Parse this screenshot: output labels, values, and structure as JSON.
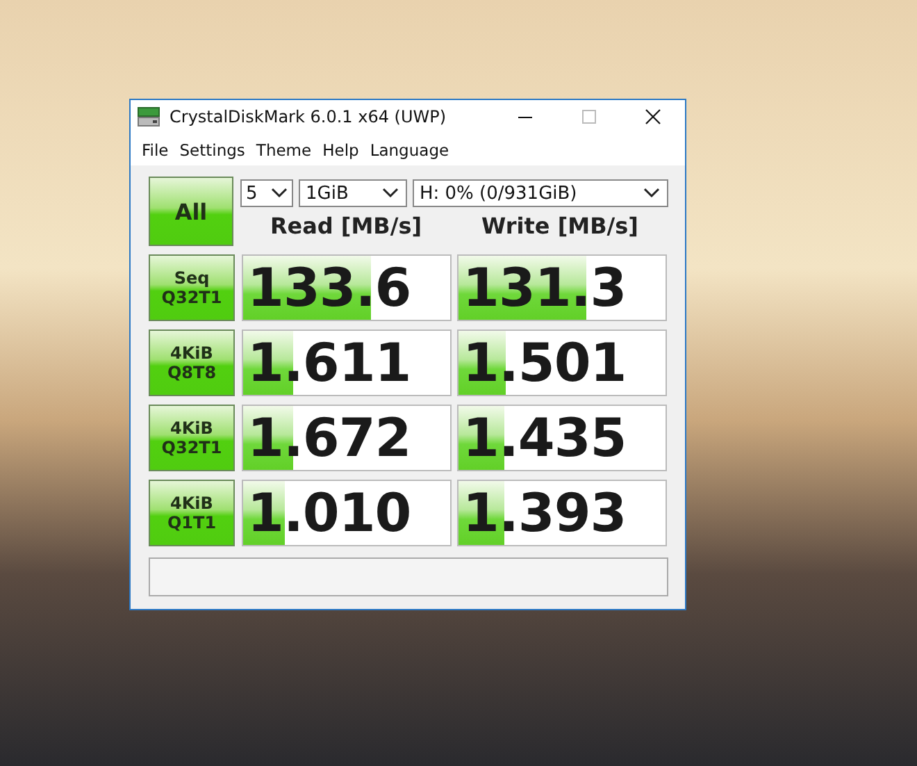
{
  "window": {
    "title": "CrystalDiskMark 6.0.1 x64 (UWP)"
  },
  "menu": [
    "File",
    "Settings",
    "Theme",
    "Help",
    "Language"
  ],
  "all_button": "All",
  "options": {
    "count": "5",
    "size": "1GiB",
    "drive": "H: 0% (0/931GiB)"
  },
  "columns": [
    "Read [MB/s]",
    "Write [MB/s]"
  ],
  "tests": [
    {
      "lines": [
        "Seq",
        "Q32T1"
      ],
      "read": {
        "value": "133.6",
        "level": 0.62
      },
      "write": {
        "value": "131.3",
        "level": 0.62
      }
    },
    {
      "lines": [
        "4KiB",
        "Q8T8"
      ],
      "read": {
        "value": "1.611",
        "level": 0.24
      },
      "write": {
        "value": "1.501",
        "level": 0.23
      }
    },
    {
      "lines": [
        "4KiB",
        "Q32T1"
      ],
      "read": {
        "value": "1.672",
        "level": 0.24
      },
      "write": {
        "value": "1.435",
        "level": 0.22
      }
    },
    {
      "lines": [
        "4KiB",
        "Q1T1"
      ],
      "read": {
        "value": "1.010",
        "level": 0.2
      },
      "write": {
        "value": "1.393",
        "level": 0.22
      }
    }
  ]
}
